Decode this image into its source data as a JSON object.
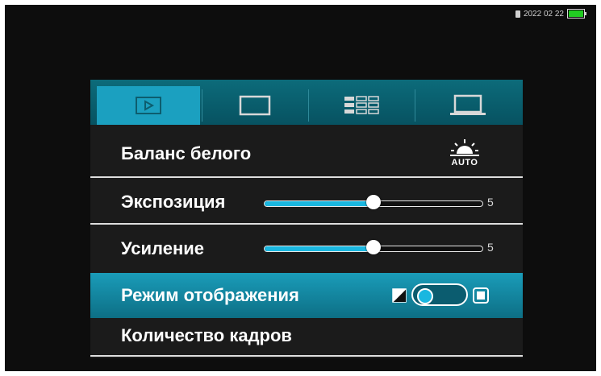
{
  "status_bar": {
    "date": "2022 02 22",
    "sd_icon": "sd-card-icon",
    "battery_icon": "battery-icon",
    "battery_color": "#22cc22"
  },
  "tabs": [
    {
      "icon": "play-icon",
      "active": true
    },
    {
      "icon": "monitor-icon",
      "active": false
    },
    {
      "icon": "grid-icon",
      "active": false
    },
    {
      "icon": "laptop-icon",
      "active": false
    }
  ],
  "menu": {
    "white_balance": {
      "label": "Баланс белого",
      "icon": "awb-auto-icon",
      "value": "AUTO"
    },
    "exposure": {
      "label": "Экспозиция",
      "value": "5",
      "fraction": 0.5
    },
    "gain": {
      "label": "Усиление",
      "value": "5",
      "fraction": 0.5
    },
    "display_mode": {
      "label": "Режим отображения",
      "toggle_state": "off",
      "left_icon": "contrast-icon",
      "right_icon": "square-frame-icon"
    },
    "frame_count": {
      "label": "Количество кадров"
    }
  },
  "colors": {
    "accent": "#1ba0c0",
    "tab_bar": "#0c6b7a",
    "selected_row": "#1a9cb9",
    "slider_fill": "#1ab7e0"
  }
}
